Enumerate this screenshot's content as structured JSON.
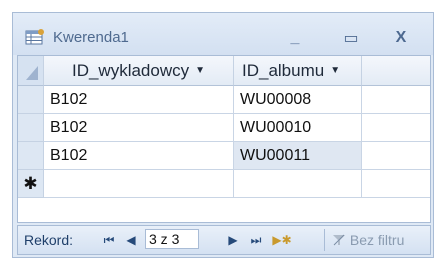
{
  "window": {
    "title": "Kwerenda1",
    "minimize_glyph": "_",
    "maximize_glyph": "▭",
    "close_glyph": "X"
  },
  "grid": {
    "columns": [
      {
        "label": "ID_wykladowcy"
      },
      {
        "label": "ID_albumu"
      }
    ],
    "rows": [
      [
        "B102",
        "WU00008"
      ],
      [
        "B102",
        "WU00010"
      ],
      [
        "B102",
        "WU00011"
      ]
    ],
    "new_row_marker": "✱"
  },
  "navigation": {
    "label": "Rekord:",
    "first_glyph": "⏮",
    "prev_glyph": "◀",
    "record_value": "3 z 3",
    "next_glyph": "▶",
    "last_glyph": "⏭",
    "new_glyph": "▶✱",
    "filter_label": "Bez filtru"
  },
  "colors": {
    "accent": "#4f6a8f",
    "grid_border": "#c9d5e5"
  }
}
